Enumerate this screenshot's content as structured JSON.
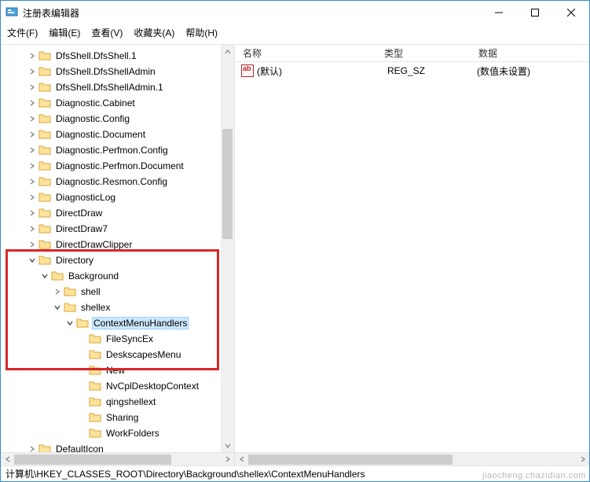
{
  "window": {
    "title": "注册表编辑器"
  },
  "menu": {
    "file": "文件(F)",
    "edit": "编辑(E)",
    "view": "查看(V)",
    "favorites": "收藏夹(A)",
    "help": "帮助(H)"
  },
  "tree": [
    {
      "depth": 2,
      "exp": "closed",
      "label": "DfsShell.DfsShell.1"
    },
    {
      "depth": 2,
      "exp": "closed",
      "label": "DfsShell.DfsShellAdmin"
    },
    {
      "depth": 2,
      "exp": "closed",
      "label": "DfsShell.DfsShellAdmin.1"
    },
    {
      "depth": 2,
      "exp": "closed",
      "label": "Diagnostic.Cabinet"
    },
    {
      "depth": 2,
      "exp": "closed",
      "label": "Diagnostic.Config"
    },
    {
      "depth": 2,
      "exp": "closed",
      "label": "Diagnostic.Document"
    },
    {
      "depth": 2,
      "exp": "closed",
      "label": "Diagnostic.Perfmon.Config"
    },
    {
      "depth": 2,
      "exp": "closed",
      "label": "Diagnostic.Perfmon.Document"
    },
    {
      "depth": 2,
      "exp": "closed",
      "label": "Diagnostic.Resmon.Config"
    },
    {
      "depth": 2,
      "exp": "closed",
      "label": "DiagnosticLog"
    },
    {
      "depth": 2,
      "exp": "closed",
      "label": "DirectDraw"
    },
    {
      "depth": 2,
      "exp": "closed",
      "label": "DirectDraw7"
    },
    {
      "depth": 2,
      "exp": "closed",
      "label": "DirectDrawClipper"
    },
    {
      "depth": 2,
      "exp": "open",
      "label": "Directory"
    },
    {
      "depth": 3,
      "exp": "open",
      "label": "Background"
    },
    {
      "depth": 4,
      "exp": "closed",
      "label": "shell"
    },
    {
      "depth": 4,
      "exp": "open",
      "label": "shellex"
    },
    {
      "depth": 5,
      "exp": "open",
      "label": "ContextMenuHandlers",
      "selected": true
    },
    {
      "depth": 6,
      "exp": "none",
      "label": "FileSyncEx"
    },
    {
      "depth": 6,
      "exp": "none",
      "label": "DeskscapesMenu"
    },
    {
      "depth": 6,
      "exp": "none",
      "label": "New"
    },
    {
      "depth": 6,
      "exp": "none",
      "label": "NvCplDesktopContext"
    },
    {
      "depth": 6,
      "exp": "none",
      "label": "qingshellext"
    },
    {
      "depth": 6,
      "exp": "none",
      "label": "Sharing"
    },
    {
      "depth": 6,
      "exp": "none",
      "label": "WorkFolders"
    },
    {
      "depth": 2,
      "exp": "closed",
      "label": "DefaultIcon"
    }
  ],
  "list": {
    "columns": {
      "name": "名称",
      "type": "类型",
      "data": "数据"
    },
    "rows": [
      {
        "name": "(默认)",
        "type": "REG_SZ",
        "data": "(数值未设置)"
      }
    ]
  },
  "status": {
    "path": "计算机\\HKEY_CLASSES_ROOT\\Directory\\Background\\shellex\\ContextMenuHandlers"
  },
  "watermark": "jiaocheng.chazidian.com"
}
